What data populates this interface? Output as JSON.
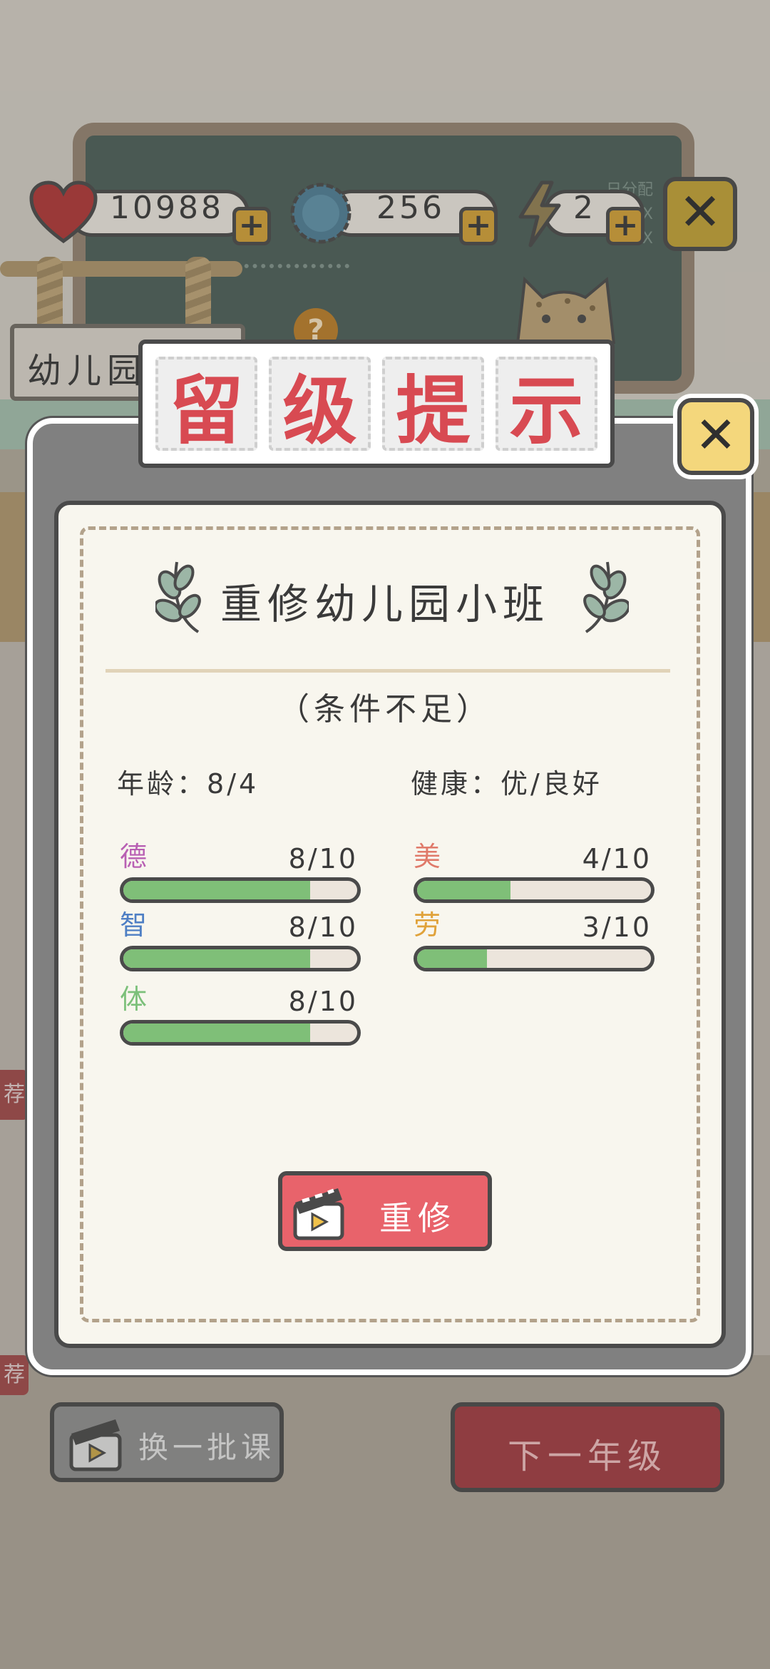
{
  "resources": {
    "hearts": "10988",
    "coins": "256",
    "energy": "2"
  },
  "background": {
    "sign_label": "幼儿园",
    "board_lines": [
      "日分配",
      "XXXX",
      "XXXX"
    ],
    "bottom_left_tag": "荐",
    "swap_courses_label": "换一批课",
    "next_grade_label": "下一年级"
  },
  "dialog": {
    "title_chars": [
      "留",
      "级",
      "提",
      "示"
    ],
    "course_name": "重修幼儿园小班",
    "condition_note": "（条件不足）",
    "age_label": "年龄：",
    "age_value": "8/4",
    "health_label": "健康：",
    "health_value": "优/良好",
    "redo_label": "重修"
  },
  "stats": [
    {
      "name": "德",
      "value": "8/10",
      "fraction": 0.8,
      "color": "#b85fb3"
    },
    {
      "name": "美",
      "value": "4/10",
      "fraction": 0.4,
      "color": "#e07a6a"
    },
    {
      "name": "智",
      "value": "8/10",
      "fraction": 0.8,
      "color": "#4e7fc4"
    },
    {
      "name": "劳",
      "value": "3/10",
      "fraction": 0.3,
      "color": "#e0a23a"
    },
    {
      "name": "体",
      "value": "8/10",
      "fraction": 0.8,
      "color": "#7cc07a"
    }
  ],
  "colors": {
    "accent_red": "#e8636b",
    "bar_fill": "#7fbf78",
    "title_red": "#d84a52"
  }
}
